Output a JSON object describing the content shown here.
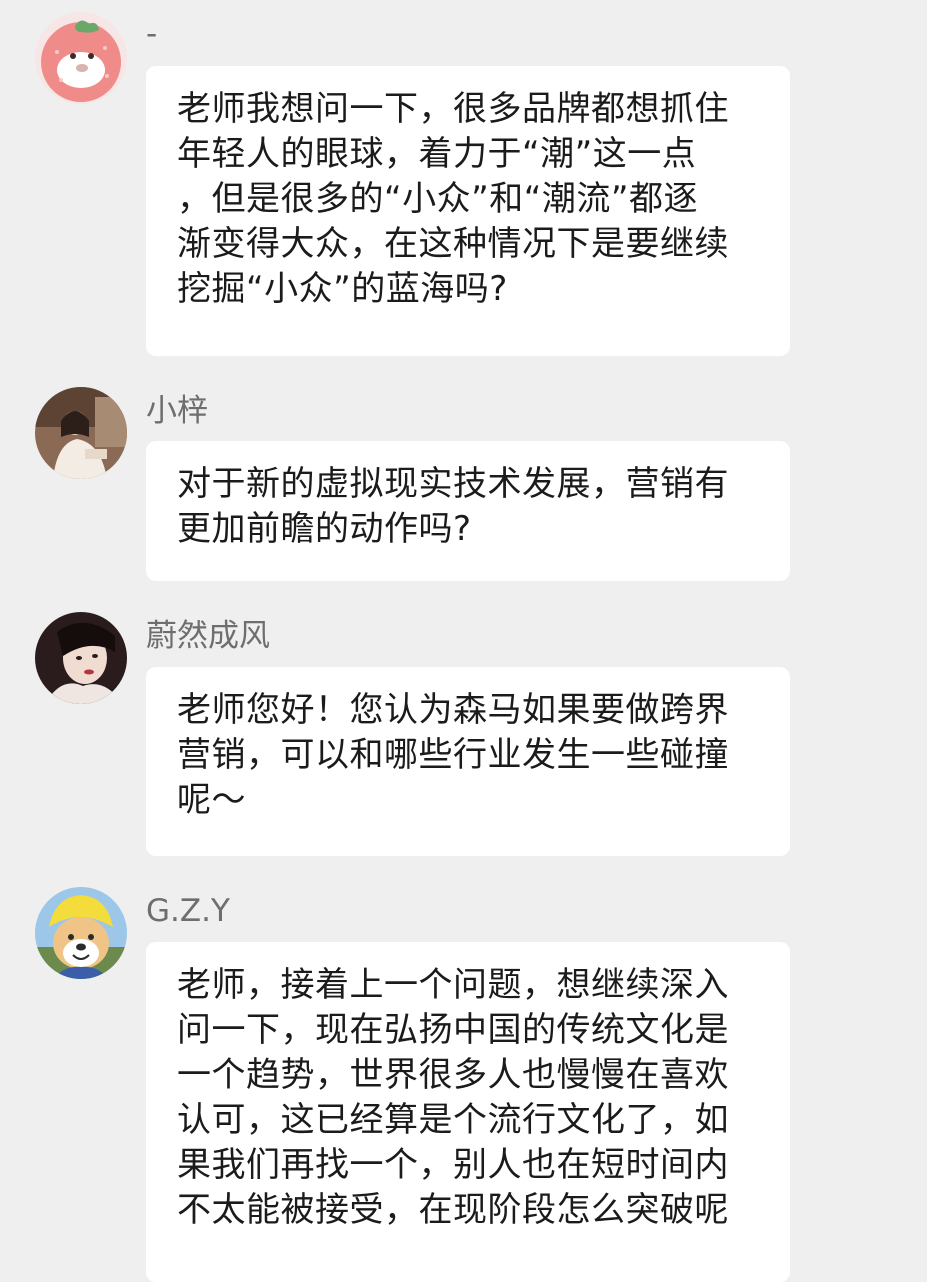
{
  "messages": [
    {
      "name": "-",
      "avatar": "strawberry-bear-avatar",
      "lines": [
        "老师我想问一下，很多品牌都想抓住",
        "年轻人的眼球，着力于“潮”这一点",
        "，但是很多的“小众”和“潮流”都逐",
        "渐变得大众，在这种情况下是要继续",
        "挖掘“小众”的蓝海吗?"
      ]
    },
    {
      "name": "小梓",
      "avatar": "woman-photo-avatar",
      "lines": [
        "对于新的虚拟现实技术发展，营销有",
        "更加前瞻的动作吗?"
      ]
    },
    {
      "name": "蔚然成风",
      "avatar": "portrait-photo-avatar",
      "lines": [
        "老师您好！您认为森马如果要做跨界",
        "营销，可以和哪些行业发生一些碰撞",
        "呢～"
      ]
    },
    {
      "name": "G.Z.Y",
      "avatar": "shiba-dog-avatar",
      "lines": [
        "老师，接着上一个问题，想继续深入",
        "问一下，现在弘扬中国的传统文化是",
        "一个趋势，世界很多人也慢慢在喜欢",
        "认可，这已经算是个流行文化了，如",
        "果我们再找一个，别人也在短时间内",
        "不太能被接受，在现阶段怎么突破呢"
      ]
    }
  ]
}
